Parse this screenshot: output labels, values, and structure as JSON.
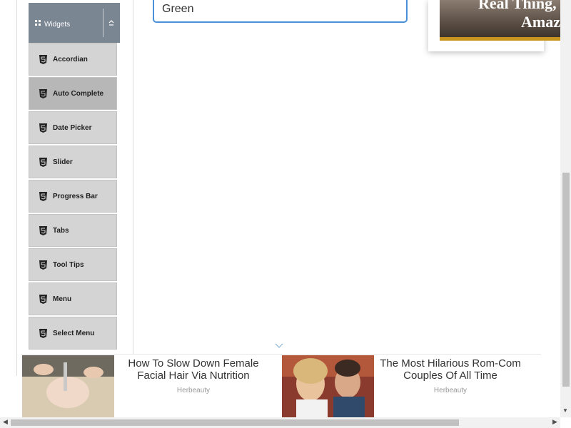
{
  "sidebar": {
    "group_label": "Widgets",
    "items": [
      {
        "label": "Accordian",
        "active": false
      },
      {
        "label": "Auto Complete",
        "active": true
      },
      {
        "label": "Date Picker",
        "active": false
      },
      {
        "label": "Slider",
        "active": false
      },
      {
        "label": "Progress Bar",
        "active": false
      },
      {
        "label": "Tabs",
        "active": false
      },
      {
        "label": "Tool Tips",
        "active": false
      },
      {
        "label": "Menu",
        "active": false
      },
      {
        "label": "Select Menu",
        "active": false
      }
    ]
  },
  "main": {
    "input_value": "Green"
  },
  "ad_top": {
    "line1": "Real Thing,",
    "line2": "Amazi"
  },
  "ads_bottom": [
    {
      "title": "How To Slow Down Female Facial Hair Via Nutrition",
      "source": "Herbeauty"
    },
    {
      "title": "The Most Hilarious Rom-Com Couples Of All Time",
      "source": "Herbeauty"
    }
  ],
  "colors": {
    "header_bg": "#7b8693",
    "item_bg": "#d4d4d4",
    "item_active_bg": "#b7b7b7",
    "input_border": "#4a90d9"
  }
}
